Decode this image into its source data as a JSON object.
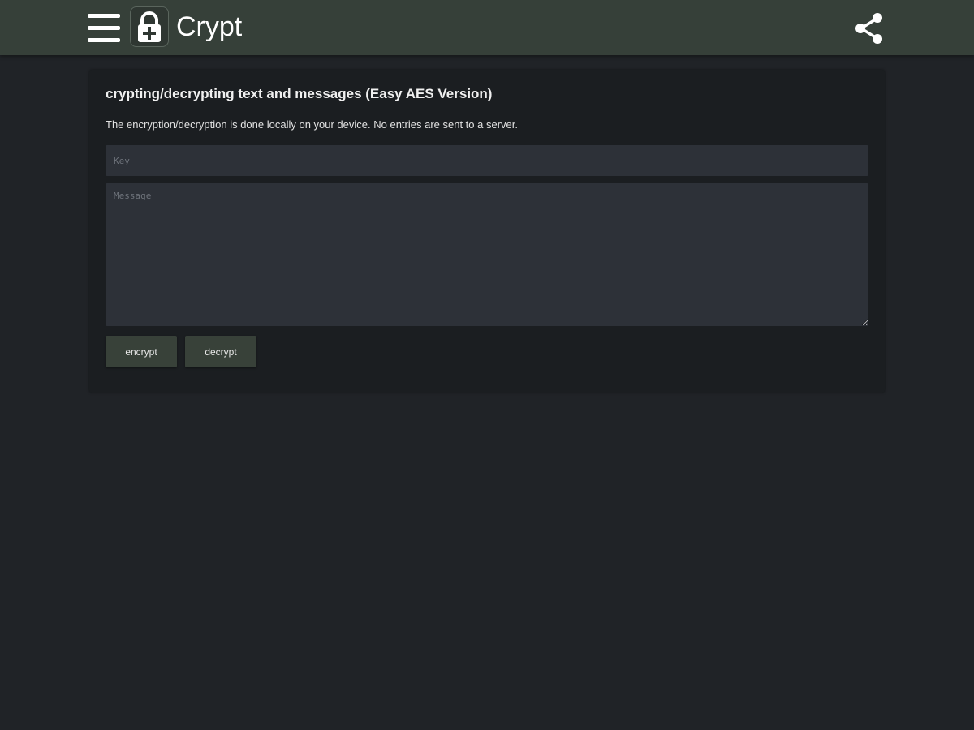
{
  "header": {
    "title": "Crypt",
    "menu_icon": "hamburger-menu-icon",
    "logo_icon": "lock-plus-icon",
    "share_icon": "share-icon",
    "background_color": "#364039"
  },
  "card": {
    "title": "crypting/decrypting text and messages (Easy AES Version)",
    "description": "The encryption/decryption is done locally on your device. No entries are sent to a server.",
    "key_field": {
      "value": "",
      "placeholder": "Key"
    },
    "message_field": {
      "value": "",
      "placeholder": "Message"
    },
    "encrypt_label": "encrypt",
    "decrypt_label": "decrypt"
  },
  "colors": {
    "page_background": "#202327",
    "card_background": "#1b1e21",
    "input_background": "#2d3138",
    "button_background": "#384139"
  }
}
